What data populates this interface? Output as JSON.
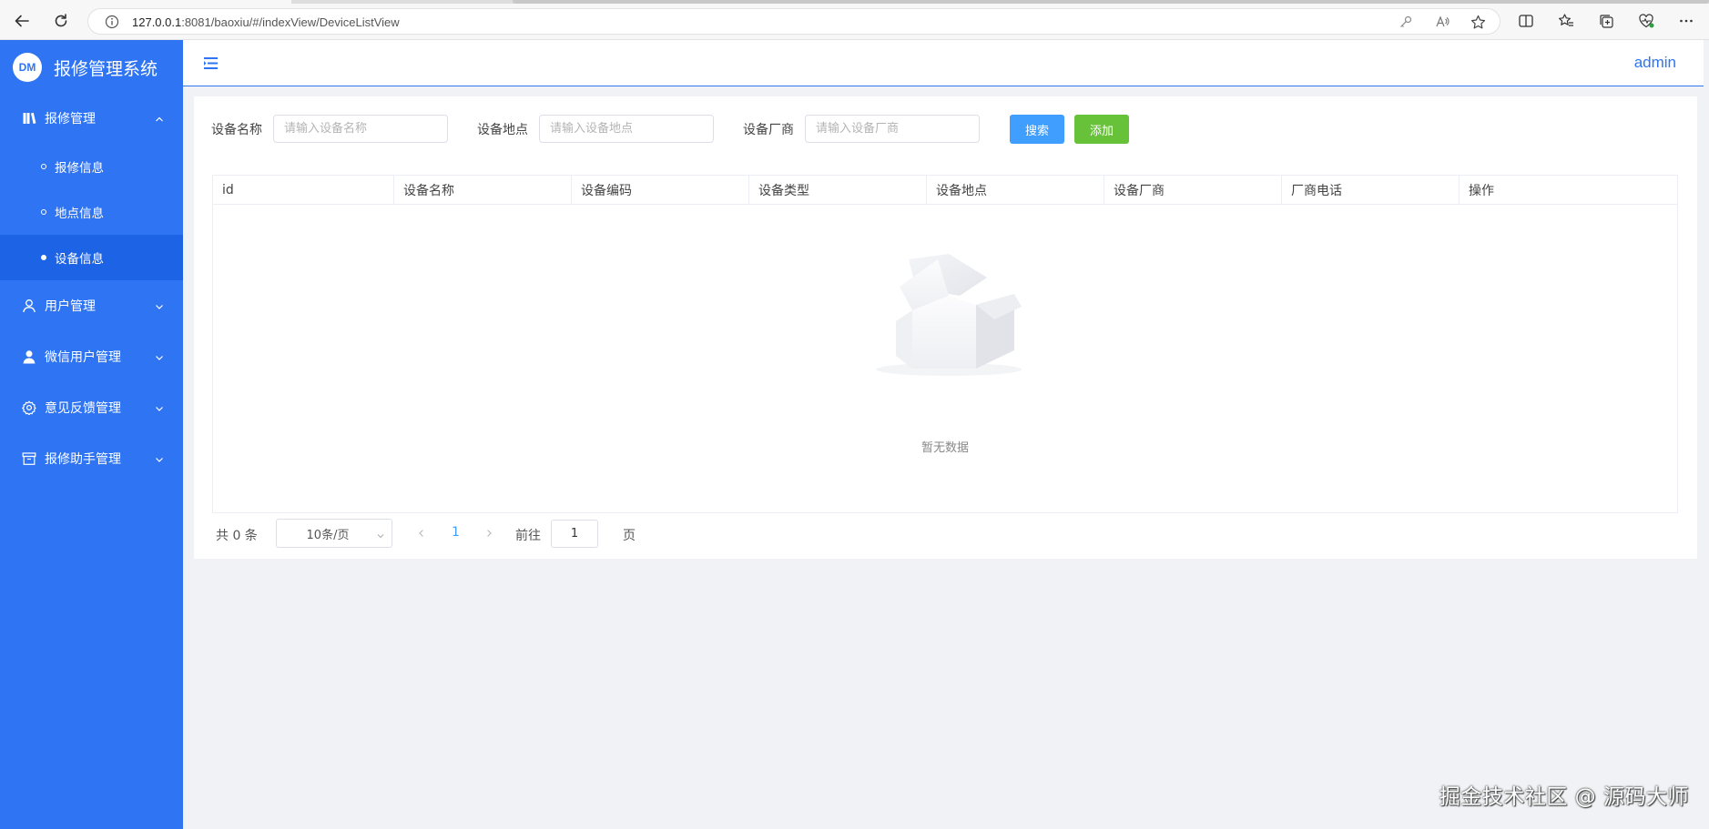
{
  "browser": {
    "url_host": "127.0.0.1",
    "url_rest": ":8081/baoxiu/#/indexView/DeviceListView"
  },
  "sidebar": {
    "logo_text": "DM",
    "title": "报修管理系统",
    "groups": [
      {
        "label": "报修管理",
        "icon": "book-icon",
        "expanded": true
      },
      {
        "label": "用户管理",
        "icon": "user-outline-icon",
        "expanded": false
      },
      {
        "label": "微信用户管理",
        "icon": "user-solid-icon",
        "expanded": false
      },
      {
        "label": "意见反馈管理",
        "icon": "gear-icon",
        "expanded": false
      },
      {
        "label": "报修助手管理",
        "icon": "archive-icon",
        "expanded": false
      }
    ],
    "subitems": [
      {
        "label": "报修信息",
        "active": false
      },
      {
        "label": "地点信息",
        "active": false
      },
      {
        "label": "设备信息",
        "active": true
      }
    ]
  },
  "header": {
    "user": "admin"
  },
  "filters": {
    "name_label": "设备名称",
    "name_placeholder": "请输入设备名称",
    "location_label": "设备地点",
    "location_placeholder": "请输入设备地点",
    "vendor_label": "设备厂商",
    "vendor_placeholder": "请输入设备厂商",
    "search_button": "搜索",
    "add_button": "添加"
  },
  "table": {
    "columns": [
      "id",
      "设备名称",
      "设备编码",
      "设备类型",
      "设备地点",
      "设备厂商",
      "厂商电话",
      "操作"
    ],
    "rows": [],
    "empty_text": "暂无数据"
  },
  "pagination": {
    "total_text": "共 0 条",
    "page_size": "10条/页",
    "current_page": "1",
    "goto_label": "前往",
    "goto_value": "1",
    "page_suffix": "页"
  },
  "watermark": "掘金技术社区 @ 源码大师",
  "colors": {
    "sidebar": "#2f74f2",
    "sidebar_active": "#1d63e6",
    "search_button": "#409eff",
    "add_button": "#67c23a"
  }
}
